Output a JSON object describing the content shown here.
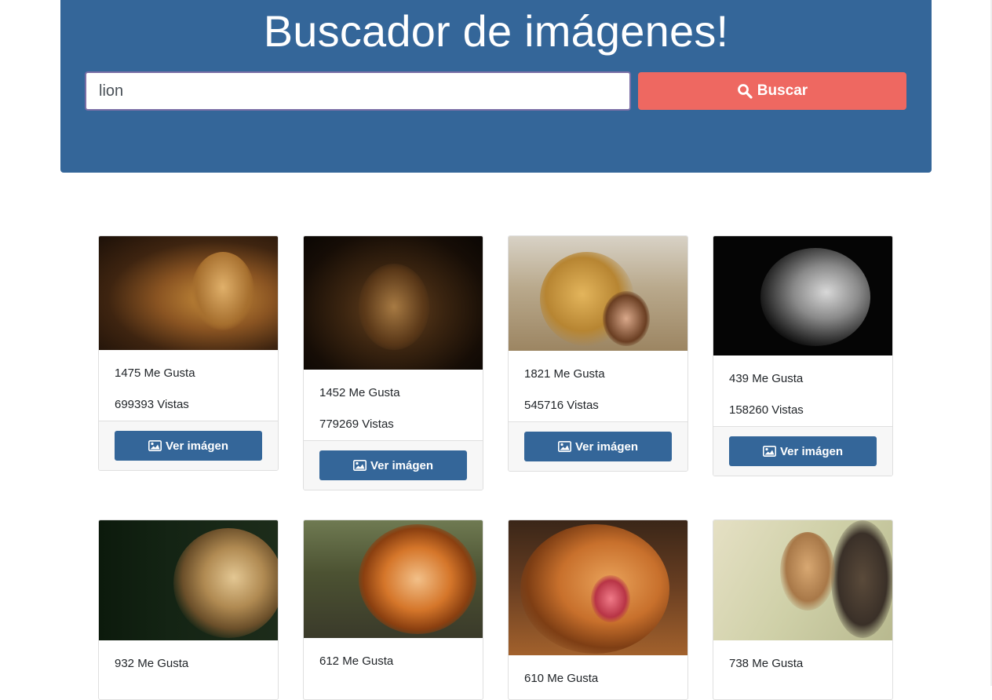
{
  "header": {
    "title": "Buscador de imágenes!",
    "search_value": "lion",
    "search_button_label": "Buscar"
  },
  "cards": [
    {
      "likes": "1475 Me Gusta",
      "views": "699393 Vistas",
      "button": "Ver imágen"
    },
    {
      "likes": "1452 Me Gusta",
      "views": "779269 Vistas",
      "button": "Ver imágen"
    },
    {
      "likes": "1821 Me Gusta",
      "views": "545716 Vistas",
      "button": "Ver imágen"
    },
    {
      "likes": "439 Me Gusta",
      "views": "158260 Vistas",
      "button": "Ver imágen"
    },
    {
      "likes": "932 Me Gusta"
    },
    {
      "likes": "612 Me Gusta"
    },
    {
      "likes": "610 Me Gusta"
    },
    {
      "likes": "738 Me Gusta"
    }
  ],
  "colors": {
    "header_bg": "#346699",
    "search_button": "#ee6861",
    "card_button": "#346699"
  },
  "icons": {
    "search": "search-icon",
    "image": "image-icon"
  }
}
